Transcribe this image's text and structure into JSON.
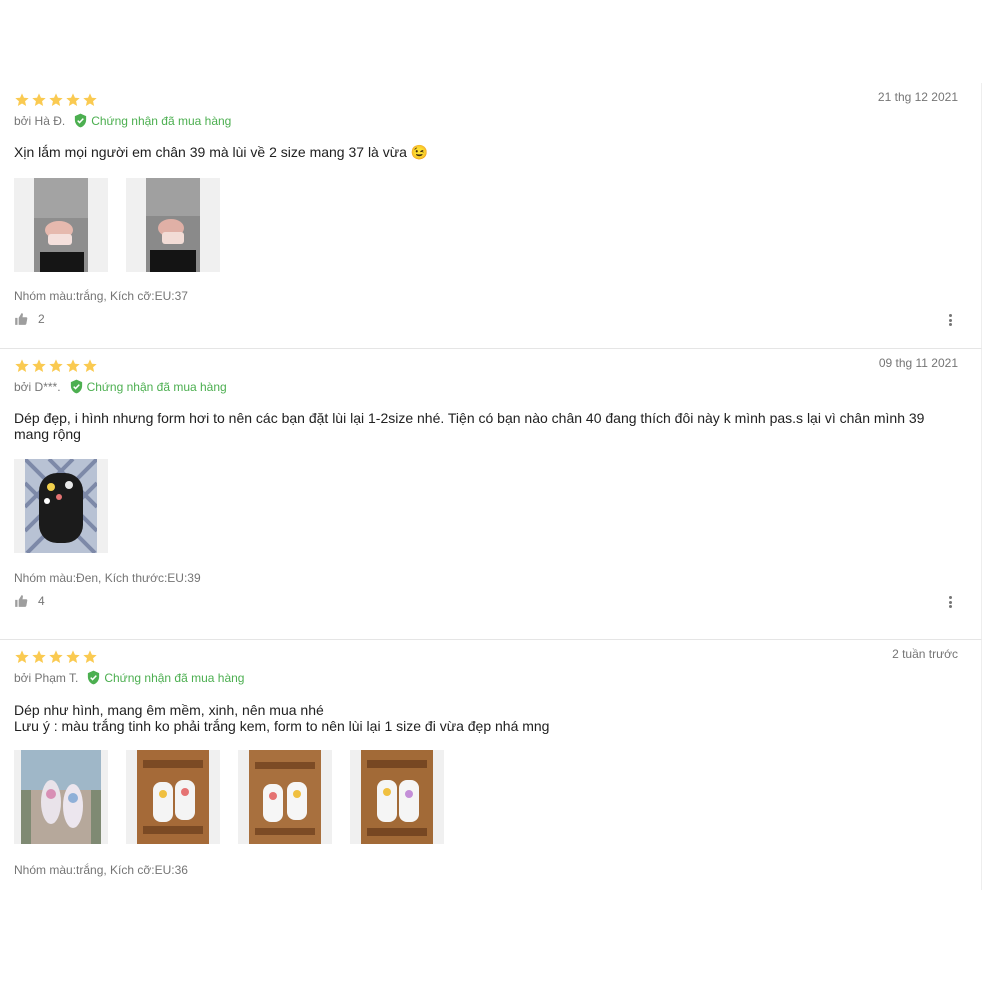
{
  "colors": {
    "star": "#faca51",
    "verified": "#4caf50",
    "muted": "#757575"
  },
  "reviews": [
    {
      "rating": 5,
      "date": "21 thg 12 2021",
      "author": "bởi Hà Đ.",
      "verified": "Chứng nhận đã mua hàng",
      "content": "Xịn lắm mọi người em chân 39 mà lùi về 2 size mang 37 là vừa 😉",
      "photos": [
        "photo-pink-sandal-1",
        "photo-pink-sandal-2"
      ],
      "sku": "Nhóm màu:trắng, Kích cỡ:EU:37",
      "likes": "2"
    },
    {
      "rating": 5,
      "date": "09 thg 11 2021",
      "author": "bởi D***.",
      "verified": "Chứng nhận đã mua hàng",
      "content": "Dép đẹp, i hình nhưng form hơi to nên các bạn đặt lùi lại 1-2size nhé. Tiện có bạn nào chân 40 đang thích đôi này k mình pas.s lại vì chân mình 39 mang rộng",
      "photos": [
        "photo-black-sandal"
      ],
      "sku": "Nhóm màu:Đen, Kích thước:EU:39",
      "likes": "4"
    },
    {
      "rating": 5,
      "date": "2 tuần trước",
      "author": "bởi Phạm T.",
      "verified": "Chứng nhận đã mua hàng",
      "content_lines": [
        "Dép như hình, mang êm mềm, xinh, nên mua nhé",
        "Lưu ý : màu trắng tinh ko phải trắng kem, form to nên lùi lại 1 size đi vừa đẹp nhá mng"
      ],
      "photos": [
        "photo-white-sandal-worn",
        "photo-white-sandal-chair-1",
        "photo-white-sandal-chair-2",
        "photo-white-sandal-chair-3"
      ],
      "sku": "Nhóm màu:trắng, Kích cỡ:EU:36"
    }
  ]
}
